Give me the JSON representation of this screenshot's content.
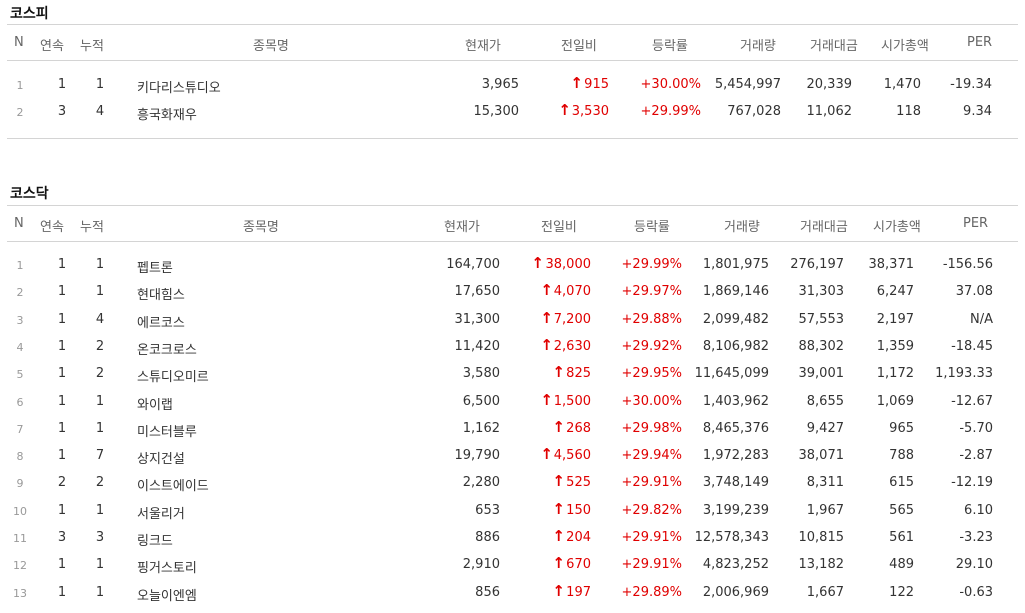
{
  "kospi": {
    "title": "코스피",
    "headers": {
      "n": "N",
      "streak": "연속",
      "cum": "누적",
      "name": "종목명",
      "price": "현재가",
      "change": "전일비",
      "rate": "등락률",
      "volume": "거래량",
      "amount": "거래대금",
      "mcap": "시가총액",
      "per": "PER"
    },
    "rows": [
      {
        "n": "1",
        "streak": "1",
        "cum": "1",
        "name": "키다리스튜디오",
        "price": "3,965",
        "change": "915",
        "rate": "+30.00%",
        "volume": "5,454,997",
        "amount": "20,339",
        "mcap": "1,470",
        "per": "-19.34"
      },
      {
        "n": "2",
        "streak": "3",
        "cum": "4",
        "name": "흥국화재우",
        "price": "15,300",
        "change": "3,530",
        "rate": "+29.99%",
        "volume": "767,028",
        "amount": "11,062",
        "mcap": "118",
        "per": "9.34"
      }
    ]
  },
  "kosdaq": {
    "title": "코스닥",
    "headers": {
      "n": "N",
      "streak": "연속",
      "cum": "누적",
      "name": "종목명",
      "price": "현재가",
      "change": "전일비",
      "rate": "등락률",
      "volume": "거래량",
      "amount": "거래대금",
      "mcap": "시가총액",
      "per": "PER"
    },
    "rows": [
      {
        "n": "1",
        "streak": "1",
        "cum": "1",
        "name": "펩트론",
        "price": "164,700",
        "change": "38,000",
        "rate": "+29.99%",
        "volume": "1,801,975",
        "amount": "276,197",
        "mcap": "38,371",
        "per": "-156.56"
      },
      {
        "n": "2",
        "streak": "1",
        "cum": "1",
        "name": "현대힘스",
        "price": "17,650",
        "change": "4,070",
        "rate": "+29.97%",
        "volume": "1,869,146",
        "amount": "31,303",
        "mcap": "6,247",
        "per": "37.08"
      },
      {
        "n": "3",
        "streak": "1",
        "cum": "4",
        "name": "에르코스",
        "price": "31,300",
        "change": "7,200",
        "rate": "+29.88%",
        "volume": "2,099,482",
        "amount": "57,553",
        "mcap": "2,197",
        "per": "N/A"
      },
      {
        "n": "4",
        "streak": "1",
        "cum": "2",
        "name": "온코크로스",
        "price": "11,420",
        "change": "2,630",
        "rate": "+29.92%",
        "volume": "8,106,982",
        "amount": "88,302",
        "mcap": "1,359",
        "per": "-18.45"
      },
      {
        "n": "5",
        "streak": "1",
        "cum": "2",
        "name": "스튜디오미르",
        "price": "3,580",
        "change": "825",
        "rate": "+29.95%",
        "volume": "11,645,099",
        "amount": "39,001",
        "mcap": "1,172",
        "per": "1,193.33"
      },
      {
        "n": "6",
        "streak": "1",
        "cum": "1",
        "name": "와이랩",
        "price": "6,500",
        "change": "1,500",
        "rate": "+30.00%",
        "volume": "1,403,962",
        "amount": "8,655",
        "mcap": "1,069",
        "per": "-12.67"
      },
      {
        "n": "7",
        "streak": "1",
        "cum": "1",
        "name": "미스터블루",
        "price": "1,162",
        "change": "268",
        "rate": "+29.98%",
        "volume": "8,465,376",
        "amount": "9,427",
        "mcap": "965",
        "per": "-5.70"
      },
      {
        "n": "8",
        "streak": "1",
        "cum": "7",
        "name": "상지건설",
        "price": "19,790",
        "change": "4,560",
        "rate": "+29.94%",
        "volume": "1,972,283",
        "amount": "38,071",
        "mcap": "788",
        "per": "-2.87"
      },
      {
        "n": "9",
        "streak": "2",
        "cum": "2",
        "name": "이스트에이드",
        "price": "2,280",
        "change": "525",
        "rate": "+29.91%",
        "volume": "3,748,149",
        "amount": "8,311",
        "mcap": "615",
        "per": "-12.19"
      },
      {
        "n": "10",
        "streak": "1",
        "cum": "1",
        "name": "서울리거",
        "price": "653",
        "change": "150",
        "rate": "+29.82%",
        "volume": "3,199,239",
        "amount": "1,967",
        "mcap": "565",
        "per": "6.10"
      },
      {
        "n": "11",
        "streak": "3",
        "cum": "3",
        "name": "링크드",
        "price": "886",
        "change": "204",
        "rate": "+29.91%",
        "volume": "12,578,343",
        "amount": "10,815",
        "mcap": "561",
        "per": "-3.23"
      },
      {
        "n": "12",
        "streak": "1",
        "cum": "1",
        "name": "핑거스토리",
        "price": "2,910",
        "change": "670",
        "rate": "+29.91%",
        "volume": "4,823,252",
        "amount": "13,182",
        "mcap": "489",
        "per": "29.10"
      },
      {
        "n": "13",
        "streak": "1",
        "cum": "1",
        "name": "오늘이엔엠",
        "price": "856",
        "change": "197",
        "rate": "+29.89%",
        "volume": "2,006,969",
        "amount": "1,667",
        "mcap": "122",
        "per": "-0.63"
      }
    ]
  },
  "icons": {
    "change_arrow": "up-arrow-icon"
  },
  "colors": {
    "up": "#e00000",
    "header_text": "#666666",
    "border": "#d4d4d4"
  }
}
